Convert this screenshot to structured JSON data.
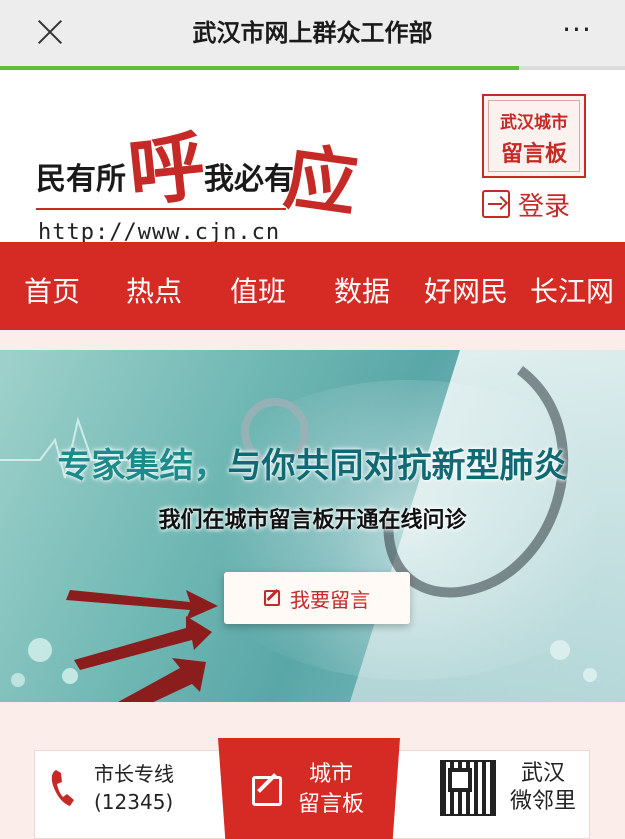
{
  "window": {
    "title": "武汉市网上群众工作部",
    "more_label": "···",
    "progress_fraction": 0.83
  },
  "header": {
    "slogan": {
      "part1": "民有所",
      "part2": "呼",
      "part3": "我必有",
      "part4": "应"
    },
    "url": "http://www.cjn.cn",
    "board_badge": {
      "line1": "武汉城市",
      "line2": "留言板"
    },
    "login_label": "登录"
  },
  "nav": {
    "items": [
      {
        "label": "首页"
      },
      {
        "label": "热点"
      },
      {
        "label": "值班"
      },
      {
        "label": "数据"
      },
      {
        "label": "好网民"
      },
      {
        "label": "长江网"
      }
    ]
  },
  "banner": {
    "headline_part1": "专家集结，",
    "headline_part2": "与你共同对抗新型肺炎",
    "subline": "我们在城市留言板开通在线问诊",
    "cta_label": "我要留言"
  },
  "quick_links": {
    "hotline_line1": "市长专线",
    "hotline_line2": "(12345)",
    "board_line1": "城市",
    "board_line2": "留言板",
    "neighbor_line1": "武汉",
    "neighbor_line2": "微邻里"
  },
  "colors": {
    "brand_red": "#d52b24",
    "progress_green": "#5fbf3a",
    "banner_teal": "#6fb7b3"
  },
  "icons": {
    "close": "close-icon",
    "more": "more-icon",
    "login": "login-icon",
    "edit": "edit-icon",
    "phone": "phone-icon",
    "qr": "qr-code-icon"
  }
}
